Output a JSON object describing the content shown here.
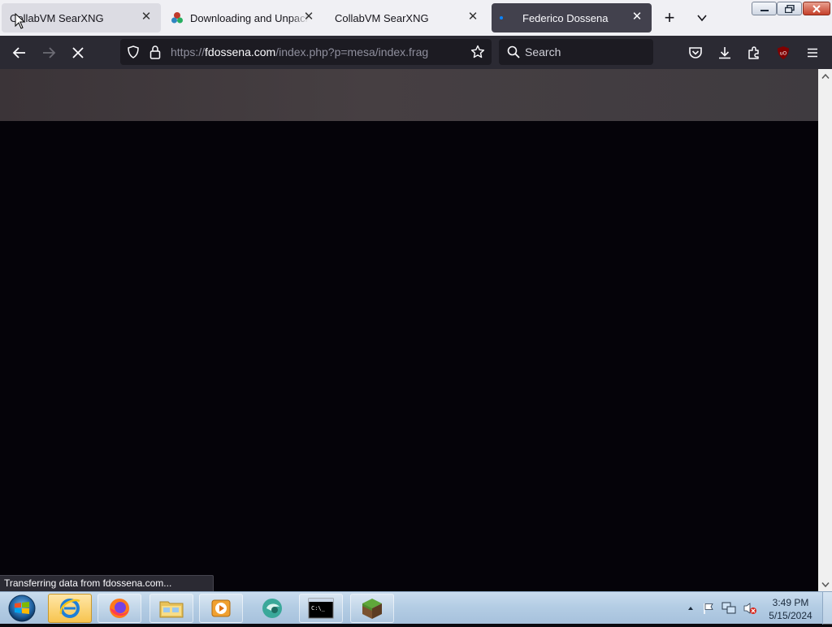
{
  "browser": {
    "tabs": [
      {
        "title": "CollabVM SearXNG",
        "state": "hovered",
        "favicon": "none"
      },
      {
        "title": "Downloading and Unpacking",
        "state": "normal",
        "favicon": "mesa-icon"
      },
      {
        "title": "CollabVM SearXNG",
        "state": "normal",
        "favicon": "none"
      },
      {
        "title": "Federico Dossena",
        "state": "active",
        "favicon": "loading-dot-icon"
      }
    ],
    "new_tab_label": "+",
    "url": {
      "scheme": "https://",
      "host": "fdossena.com",
      "path": "/index.php?p=mesa/index.frag"
    },
    "search_placeholder": "Search",
    "status_text": "Transferring data from fdossena.com..."
  },
  "colors": {
    "accent_active_tab": "#42414d",
    "toolbar": "#2b2a33",
    "field": "#1c1b22",
    "page_header": "#443d41",
    "page_body": "#050309",
    "ublock": "#800000"
  },
  "taskbar": {
    "items": [
      {
        "name": "internet-explorer-icon",
        "active": true
      },
      {
        "name": "firefox-icon",
        "active": false
      },
      {
        "name": "file-explorer-icon",
        "active": false
      },
      {
        "name": "media-player-icon",
        "active": false
      },
      {
        "name": "hyperspace-browser-icon",
        "active": false
      },
      {
        "name": "command-prompt-icon",
        "active": false
      },
      {
        "name": "minecraft-icon",
        "active": false
      }
    ],
    "clock": {
      "time": "3:49 PM",
      "date": "5/15/2024"
    },
    "tray_icons": [
      "show-hidden-icons-icon",
      "action-center-flag-icon",
      "network-icon",
      "volume-muted-icon"
    ]
  }
}
